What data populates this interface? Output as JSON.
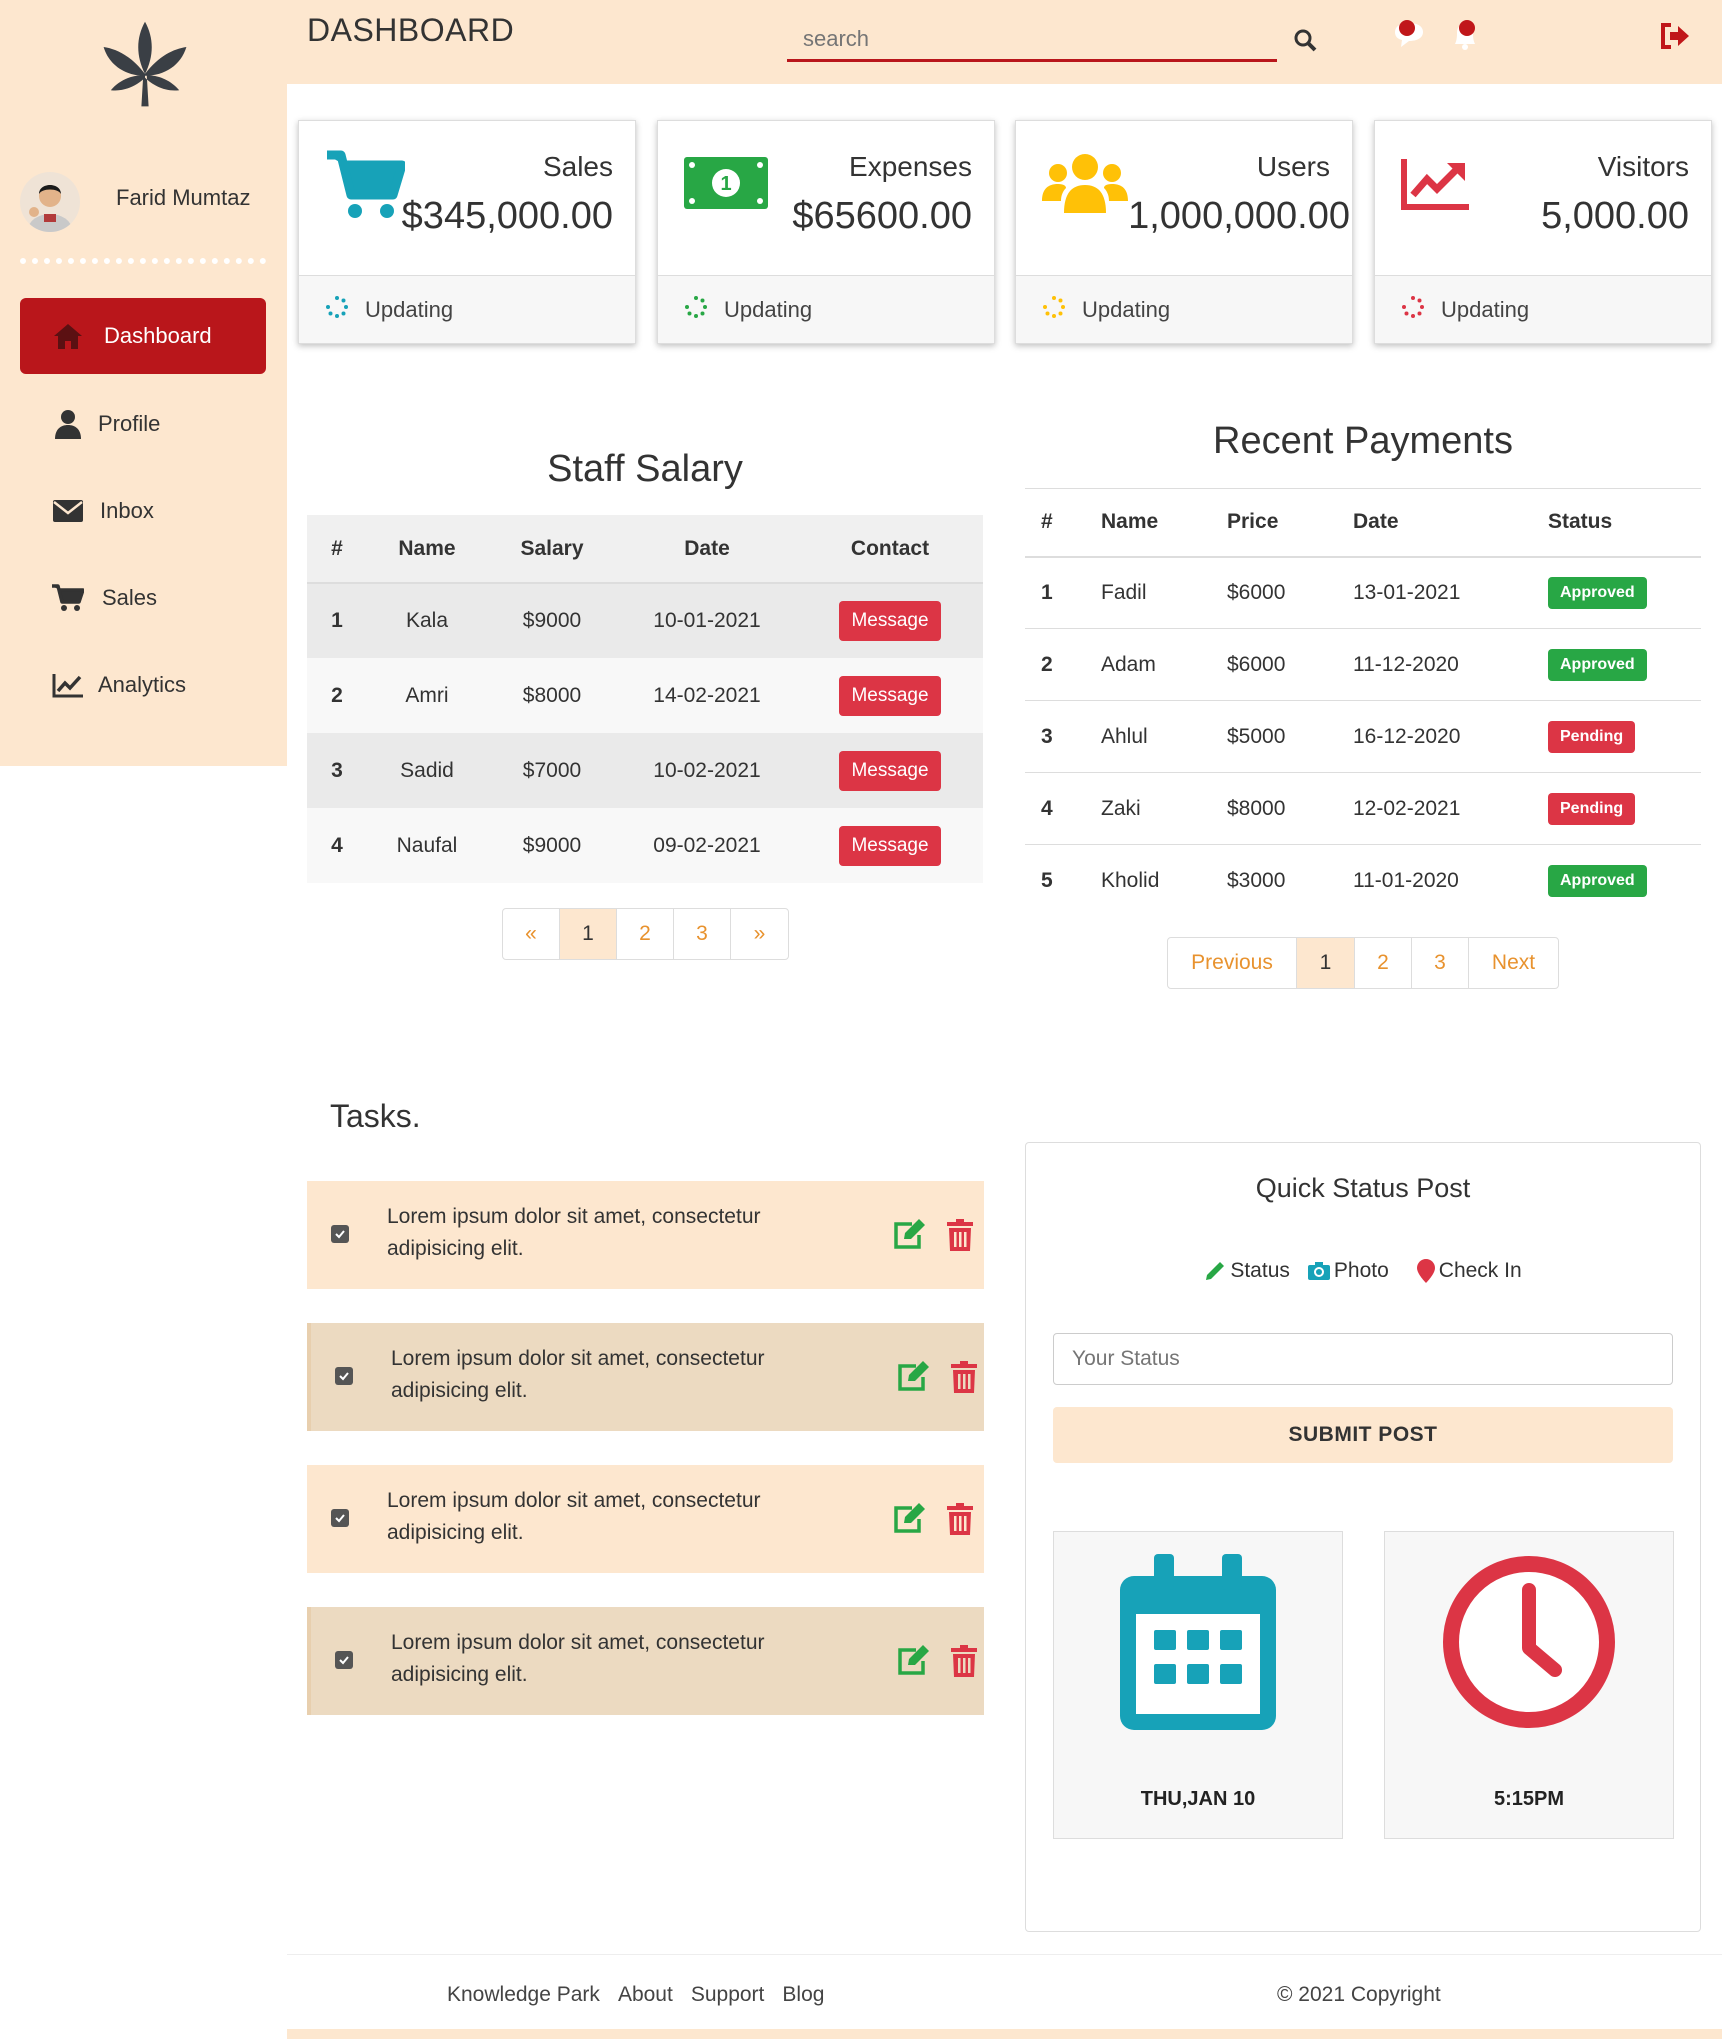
{
  "colors": {
    "brand": "#fde7cf",
    "accent": "#b9161b",
    "danger": "#dc3545",
    "success": "#28a745",
    "teal": "#17a2b8",
    "warning": "#ffc107"
  },
  "header": {
    "title": "DASHBOARD",
    "search_placeholder": "search"
  },
  "sidebar": {
    "user_name": "Farid Mumtaz",
    "items": [
      {
        "label": "Dashboard",
        "icon": "home-icon",
        "active": true
      },
      {
        "label": "Profile",
        "icon": "user-icon"
      },
      {
        "label": "Inbox",
        "icon": "envelope-icon"
      },
      {
        "label": "Sales",
        "icon": "cart-icon"
      },
      {
        "label": "Analytics",
        "icon": "chart-line-icon"
      }
    ]
  },
  "cards": [
    {
      "label": "Sales",
      "value": "$345,000.00",
      "status": "Updating",
      "icon": "shopping-cart-icon"
    },
    {
      "label": "Expenses",
      "value": "$65600.00",
      "status": "Updating",
      "icon": "money-bill-icon"
    },
    {
      "label": "Users",
      "value": "1,000,000.00",
      "status": "Updating",
      "icon": "users-icon"
    },
    {
      "label": "Visitors",
      "value": "5,000.00",
      "status": "Updating",
      "icon": "chart-area-icon"
    }
  ],
  "salary": {
    "title": "Staff Salary",
    "columns": [
      "#",
      "Name",
      "Salary",
      "Date",
      "Contact"
    ],
    "rows": [
      {
        "num": "1",
        "name": "Kala",
        "salary": "$9000",
        "date": "10-01-2021",
        "action": "Message"
      },
      {
        "num": "2",
        "name": "Amri",
        "salary": "$8000",
        "date": "14-02-2021",
        "action": "Message"
      },
      {
        "num": "3",
        "name": "Sadid",
        "salary": "$7000",
        "date": "10-02-2021",
        "action": "Message"
      },
      {
        "num": "4",
        "name": "Naufal",
        "salary": "$9000",
        "date": "09-02-2021",
        "action": "Message"
      }
    ],
    "pager": [
      "«",
      "1",
      "2",
      "3",
      "»"
    ]
  },
  "payments": {
    "title": "Recent Payments",
    "columns": [
      "#",
      "Name",
      "Price",
      "Date",
      "Status"
    ],
    "rows": [
      {
        "num": "1",
        "name": "Fadil",
        "price": "$6000",
        "date": "13-01-2021",
        "status": "Approved"
      },
      {
        "num": "2",
        "name": "Adam",
        "price": "$6000",
        "date": "11-12-2020",
        "status": "Approved"
      },
      {
        "num": "3",
        "name": "Ahlul",
        "price": "$5000",
        "date": "16-12-2020",
        "status": "Pending"
      },
      {
        "num": "4",
        "name": "Zaki",
        "price": "$8000",
        "date": "12-02-2021",
        "status": "Pending"
      },
      {
        "num": "5",
        "name": "Kholid",
        "price": "$3000",
        "date": "11-01-2020",
        "status": "Approved"
      }
    ],
    "pager": [
      "Previous",
      "1",
      "2",
      "3",
      "Next"
    ]
  },
  "tasks": {
    "title": "Tasks.",
    "items": [
      {
        "text": "Lorem ipsum dolor sit amet, consectetur adipisicing elit."
      },
      {
        "text": "Lorem ipsum dolor sit amet, consectetur adipisicing elit."
      },
      {
        "text": "Lorem ipsum dolor sit amet, consectetur adipisicing elit."
      },
      {
        "text": "Lorem ipsum dolor sit amet, consectetur adipisicing elit."
      }
    ]
  },
  "quick_post": {
    "title": "Quick Status Post",
    "tabs": {
      "status": "Status",
      "photo": "Photo",
      "checkin": "Check In"
    },
    "input_placeholder": "Your Status",
    "submit": "SUBMIT POST",
    "date_label": "THU,JAN 10",
    "time_label": "5:15PM"
  },
  "footer": {
    "links": [
      "Knowledge Park",
      "About",
      "Support",
      "Blog"
    ],
    "copyright": "© 2021 Copyright"
  }
}
